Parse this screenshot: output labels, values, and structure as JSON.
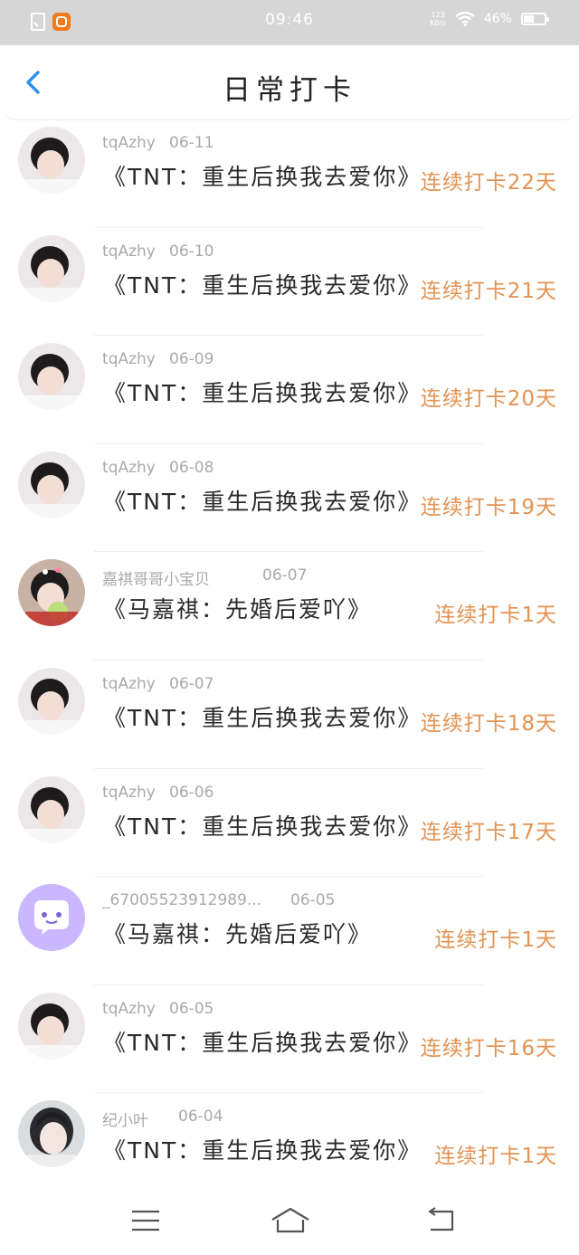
{
  "status_bar": {
    "time": "09:46",
    "net_rate_top": "123",
    "net_rate_bottom": "KB/s",
    "battery": "46%"
  },
  "header": {
    "title": "日常打卡",
    "back_icon": "back-chevron-icon"
  },
  "rows": [
    {
      "user": "tqAzhy",
      "date": "06-11",
      "book": "《TNT：重生后换我去爱你》",
      "streak": "连续打卡22天",
      "avatar": "boy-photo"
    },
    {
      "user": "tqAzhy",
      "date": "06-10",
      "book": "《TNT：重生后换我去爱你》",
      "streak": "连续打卡21天",
      "avatar": "boy-photo"
    },
    {
      "user": "tqAzhy",
      "date": "06-09",
      "book": "《TNT：重生后换我去爱你》",
      "streak": "连续打卡20天",
      "avatar": "boy-photo"
    },
    {
      "user": "tqAzhy",
      "date": "06-08",
      "book": "《TNT：重生后换我去爱你》",
      "streak": "连续打卡19天",
      "avatar": "boy-photo"
    },
    {
      "user": "嘉祺哥哥小宝贝",
      "date": "06-07",
      "book": "《马嘉祺：先婚后爱吖》",
      "streak": "连续打卡1天",
      "avatar": "boy-photo-balloon"
    },
    {
      "user": "tqAzhy",
      "date": "06-07",
      "book": "《TNT：重生后换我去爱你》",
      "streak": "连续打卡18天",
      "avatar": "boy-photo"
    },
    {
      "user": "tqAzhy",
      "date": "06-06",
      "book": "《TNT：重生后换我去爱你》",
      "streak": "连续打卡17天",
      "avatar": "boy-photo"
    },
    {
      "user": "_67005523912989...",
      "date": "06-05",
      "book": "《马嘉祺：先婚后爱吖》",
      "streak": "连续打卡1天",
      "avatar": "default-chat-avatar"
    },
    {
      "user": "tqAzhy",
      "date": "06-05",
      "book": "《TNT：重生后换我去爱你》",
      "streak": "连续打卡16天",
      "avatar": "boy-photo"
    },
    {
      "user": "纪小叶",
      "date": "06-04",
      "book": "《TNT：重生后换我去爱你》",
      "streak": "连续打卡1天",
      "avatar": "girl-photo"
    }
  ],
  "nav_bar": {
    "menu_icon": "menu-icon",
    "home_icon": "home-icon",
    "back_icon": "back-icon"
  },
  "colors": {
    "streak": "#e39352",
    "back_arrow": "#2d8ff0",
    "default_avatar": "#c9b7ff"
  }
}
